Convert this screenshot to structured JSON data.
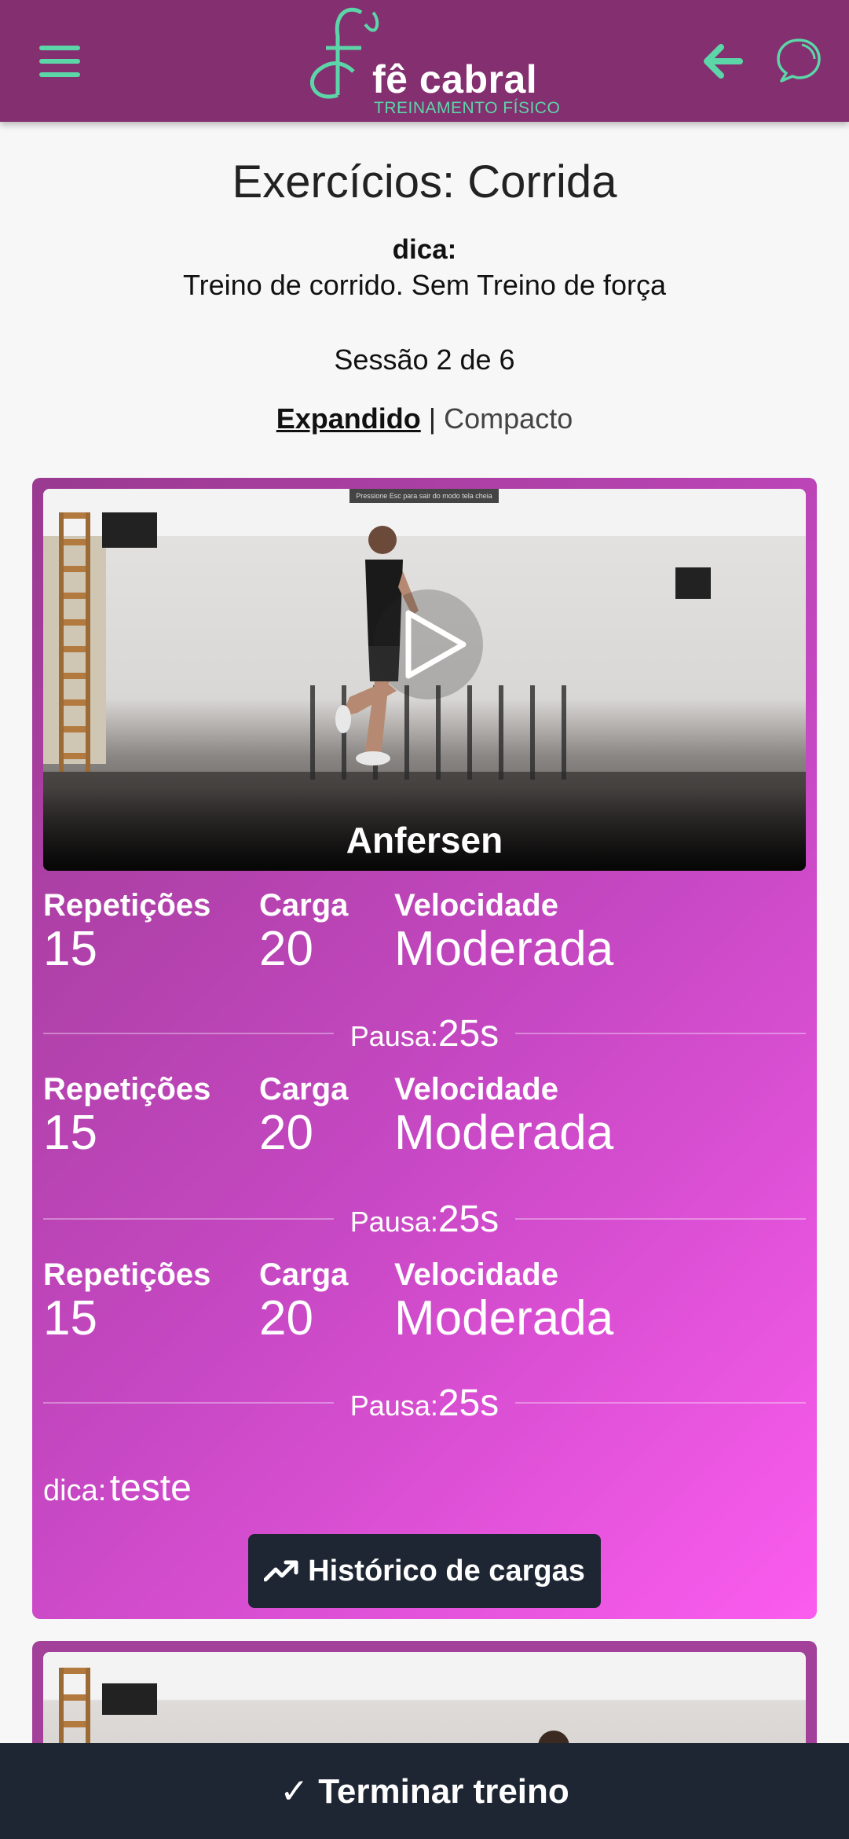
{
  "header": {
    "logo_name": "fê cabral",
    "logo_subtitle": "TREINAMENTO FÍSICO",
    "menu_icon": "hamburger-menu-icon",
    "back_icon": "arrow-left-icon",
    "chat_icon": "chat-bubble-icon",
    "colors": {
      "bar": "#842f6f",
      "accent": "#5cd6a8"
    }
  },
  "page": {
    "title": "Exercícios: Corrida",
    "tip_label": "dica:",
    "tip_text": "Treino de corrido. Sem Treino de força",
    "session": "Sessão 2 de 6",
    "view_expanded": "Expandido",
    "view_separator": "|",
    "view_compact": "Compacto"
  },
  "exercise": {
    "name": "Anfersen",
    "video_banner": "Pressione Esc para sair do modo tela cheia",
    "sets": [
      {
        "reps_label": "Repetições",
        "reps": "15",
        "load_label": "Carga",
        "load": "20",
        "speed_label": "Velocidade",
        "speed": "Moderada",
        "pause_label": "Pausa:",
        "pause": "25s"
      },
      {
        "reps_label": "Repetições",
        "reps": "15",
        "load_label": "Carga",
        "load": "20",
        "speed_label": "Velocidade",
        "speed": "Moderada",
        "pause_label": "Pausa:",
        "pause": "25s"
      },
      {
        "reps_label": "Repetições",
        "reps": "15",
        "load_label": "Carga",
        "load": "20",
        "speed_label": "Velocidade",
        "speed": "Moderada",
        "pause_label": "Pausa:",
        "pause": "25s"
      }
    ],
    "tip_label": "dica:",
    "tip_value": "teste",
    "history_button": "Histórico de cargas"
  },
  "footer": {
    "finish_button": "✓ Terminar treino"
  }
}
